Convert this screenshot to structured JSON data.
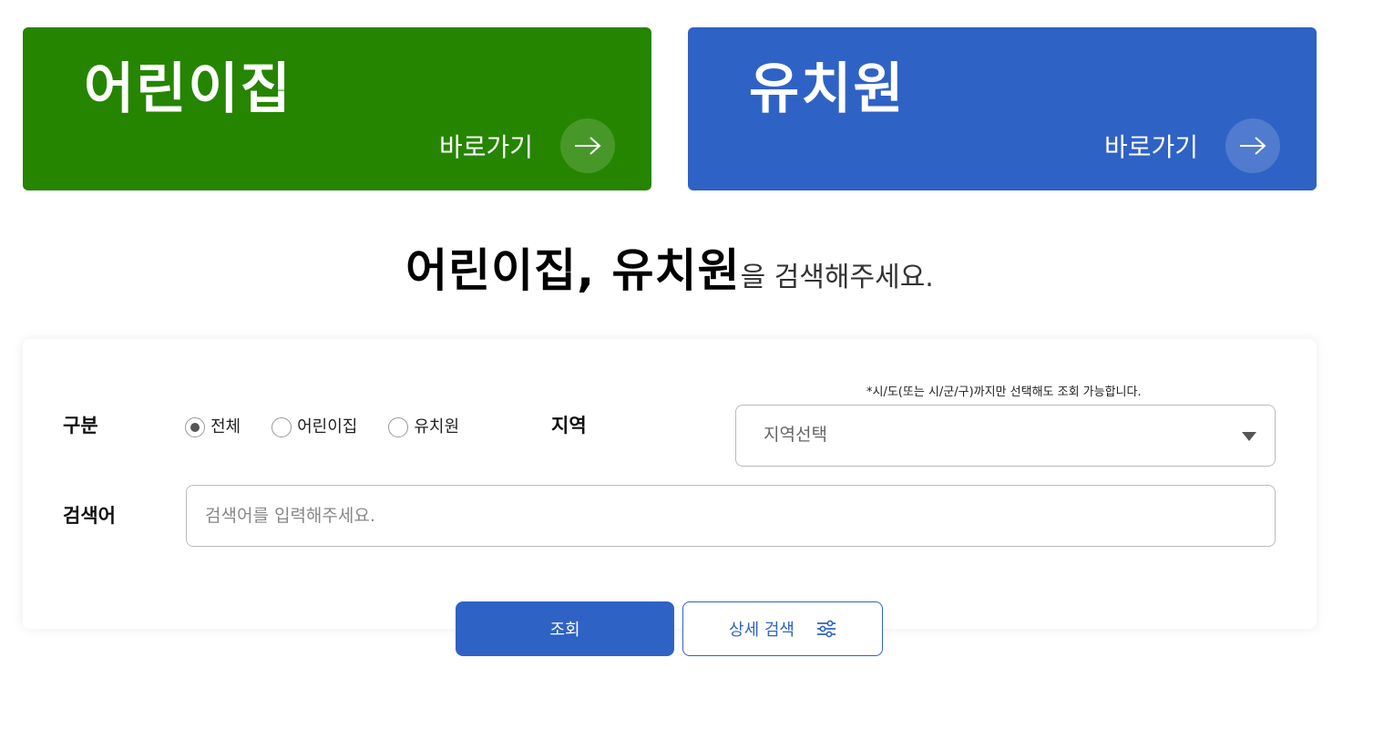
{
  "colors": {
    "green_banner": "#258500",
    "blue_banner": "#2f62c5",
    "primary": "#2f62c5"
  },
  "banners": [
    {
      "title": "어린이집",
      "link_label": "바로가기",
      "icon": "arrow-right-icon"
    },
    {
      "title": "유치원",
      "link_label": "바로가기",
      "icon": "arrow-right-icon"
    }
  ],
  "headline": {
    "strong": "어린이집, 유치원",
    "light": "을 검색해주세요."
  },
  "search": {
    "category_label": "구분",
    "options": [
      {
        "label": "전체",
        "checked": true
      },
      {
        "label": "어린이집",
        "checked": false
      },
      {
        "label": "유치원",
        "checked": false
      }
    ],
    "region_label": "지역",
    "region_note": "*시/도(또는 시/군/구)까지만 선택해도 조회 가능합니다.",
    "region_selected": "지역선택",
    "keyword_label": "검색어",
    "keyword_placeholder": "검색어를 입력해주세요.",
    "keyword_value": ""
  },
  "buttons": {
    "submit_label": "조회",
    "detail_label": "상세 검색",
    "detail_icon": "sliders-icon"
  }
}
